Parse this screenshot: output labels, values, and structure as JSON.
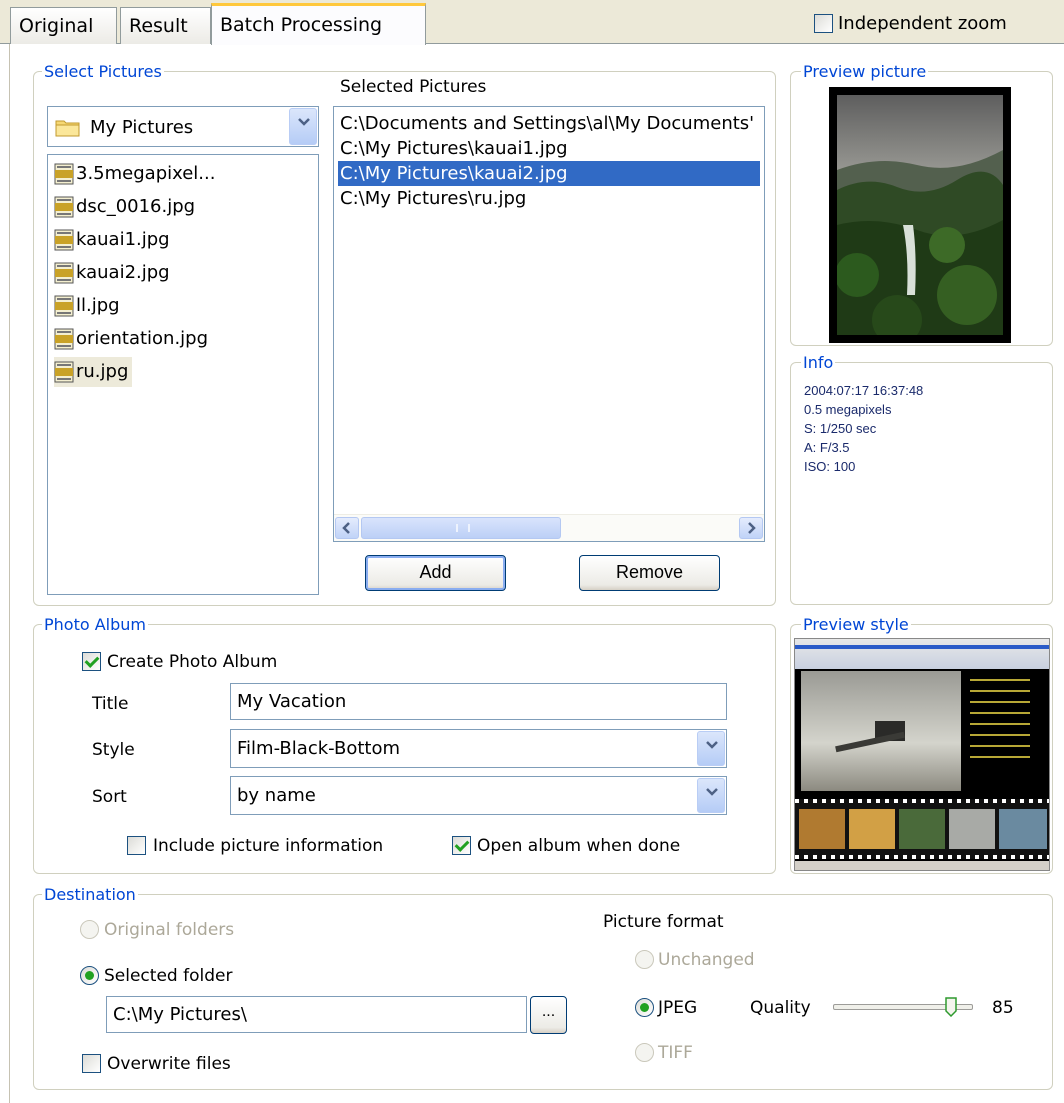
{
  "tabs": [
    {
      "label": "Original"
    },
    {
      "label": "Result"
    },
    {
      "label": "Batch Processing"
    }
  ],
  "independent_zoom": {
    "label": "Independent zoom",
    "checked": false
  },
  "select_pictures": {
    "legend": "Select Pictures",
    "folder": "My Pictures",
    "files": [
      "3.5megapixel...",
      "dsc_0016.jpg",
      "kauai1.jpg",
      "kauai2.jpg",
      "ll.jpg",
      "orientation.jpg",
      "ru.jpg"
    ],
    "selected_header": "Selected Pictures",
    "selected_items": [
      "C:\\Documents and Settings\\al\\My Documents'",
      "C:\\My Pictures\\kauai1.jpg",
      "C:\\My Pictures\\kauai2.jpg",
      "C:\\My Pictures\\ru.jpg"
    ],
    "add_label": "Add",
    "remove_label": "Remove"
  },
  "preview_picture": {
    "legend": "Preview picture"
  },
  "info": {
    "legend": "Info",
    "lines": [
      "2004:07:17 16:37:48",
      "0.5 megapixels",
      "S: 1/250 sec",
      "A: F/3.5",
      "ISO: 100"
    ]
  },
  "photo_album": {
    "legend": "Photo Album",
    "create_label": "Create Photo Album",
    "create_checked": true,
    "title_label": "Title",
    "title_value": "My Vacation",
    "style_label": "Style",
    "style_value": "Film-Black-Bottom",
    "sort_label": "Sort",
    "sort_value": "by name",
    "include_info_label": "Include picture information",
    "include_info_checked": false,
    "open_album_label": "Open album when done",
    "open_album_checked": true
  },
  "preview_style": {
    "legend": "Preview style"
  },
  "destination": {
    "legend": "Destination",
    "original_folders": "Original folders",
    "selected_folder": "Selected folder",
    "folder_path": "C:\\My Pictures\\",
    "browse_label": "...",
    "overwrite_label": "Overwrite files",
    "picture_format_label": "Picture format",
    "unchanged_label": "Unchanged",
    "jpeg_label": "JPEG",
    "tiff_label": "TIFF",
    "quality_label": "Quality",
    "quality_value": "85"
  }
}
